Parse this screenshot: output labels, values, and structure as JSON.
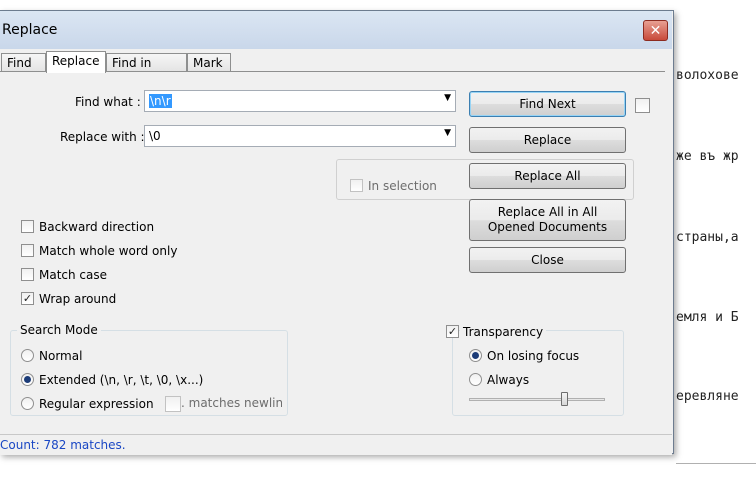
{
  "background": {
    "lines": [
      "волохове",
      "же въ жр",
      "страны,а",
      "емля и Б",
      "еревляне"
    ]
  },
  "window": {
    "title": "Replace",
    "close_label": "✕"
  },
  "tabs": [
    {
      "label": "Find"
    },
    {
      "label": "Replace"
    },
    {
      "label": "Find in Files"
    },
    {
      "label": "Mark"
    }
  ],
  "form": {
    "find_label": "Find what :",
    "find_value": "\\n\\r",
    "replace_label": "Replace with :",
    "replace_value": "\\0",
    "in_selection_label": "In selection"
  },
  "buttons": {
    "find_next": "Find Next",
    "replace": "Replace",
    "replace_all": "Replace All",
    "replace_all_opened": "Replace All in All Opened Documents",
    "close": "Close"
  },
  "options": {
    "backward": "Backward direction",
    "whole_word": "Match whole word only",
    "match_case": "Match case",
    "wrap_around": "Wrap around"
  },
  "search_mode": {
    "title": "Search Mode",
    "normal": "Normal",
    "extended": "Extended (\\n, \\r, \\t, \\0, \\x...)",
    "regex": "Regular expression",
    "matches_newline": ". matches newline"
  },
  "transparency": {
    "title": "Transparency",
    "on_losing_focus": "On losing focus",
    "always": "Always",
    "slider_value": 0.7
  },
  "status": {
    "text": "Count: 782 matches."
  }
}
